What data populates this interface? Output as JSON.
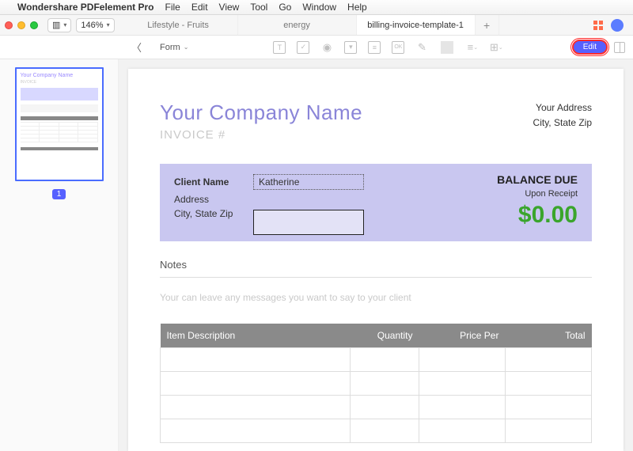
{
  "menubar": {
    "app_name": "Wondershare PDFelement Pro",
    "items": [
      "File",
      "Edit",
      "View",
      "Tool",
      "Go",
      "Window",
      "Help"
    ]
  },
  "toolbar": {
    "zoom": "146%",
    "tabs": [
      {
        "label": "Lifestyle - Fruits",
        "active": false
      },
      {
        "label": "energy",
        "active": false
      },
      {
        "label": "billing-invoice-template-1",
        "active": true
      }
    ]
  },
  "toolbar2": {
    "form_label": "Form",
    "edit_label": "Edit"
  },
  "sidebar": {
    "page_number": "1"
  },
  "invoice": {
    "company_name": "Your Company Name",
    "invoice_label": "INVOICE #",
    "your_address_line1": "Your Address",
    "your_address_line2": "City, State Zip",
    "client_name_label": "Client Name",
    "client_name_value": "Katherine",
    "address_label": "Address",
    "city_label": "City, State Zip",
    "balance_due_label": "BALANCE DUE",
    "upon_receipt": "Upon Receipt",
    "amount": "$0.00",
    "notes_label": "Notes",
    "notes_placeholder": "Your can leave any messages you want to say to your client",
    "columns": {
      "item": "Item Description",
      "qty": "Quantity",
      "price": "Price Per",
      "total": "Total"
    }
  }
}
